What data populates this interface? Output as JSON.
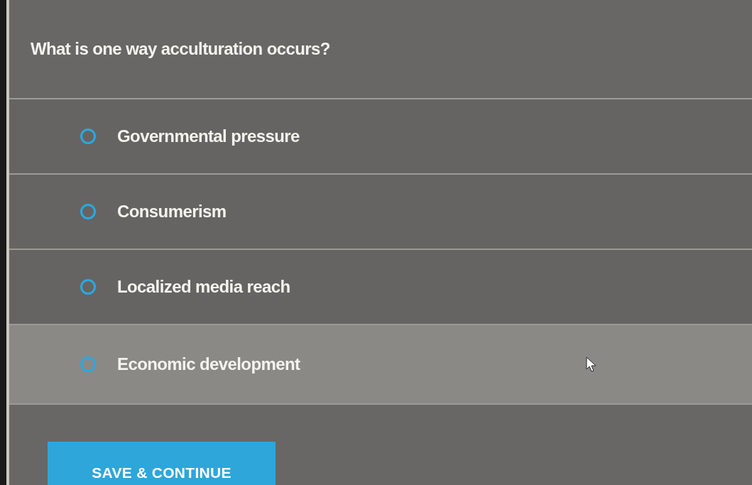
{
  "question": "What is one way acculturation occurs?",
  "options": [
    {
      "label": "Governmental pressure",
      "selected": false,
      "hovered": false
    },
    {
      "label": "Consumerism",
      "selected": false,
      "hovered": false
    },
    {
      "label": "Localized media reach",
      "selected": false,
      "hovered": false
    },
    {
      "label": "Economic development",
      "selected": false,
      "hovered": true
    }
  ],
  "button": {
    "label": "SAVE & CONTINUE"
  }
}
